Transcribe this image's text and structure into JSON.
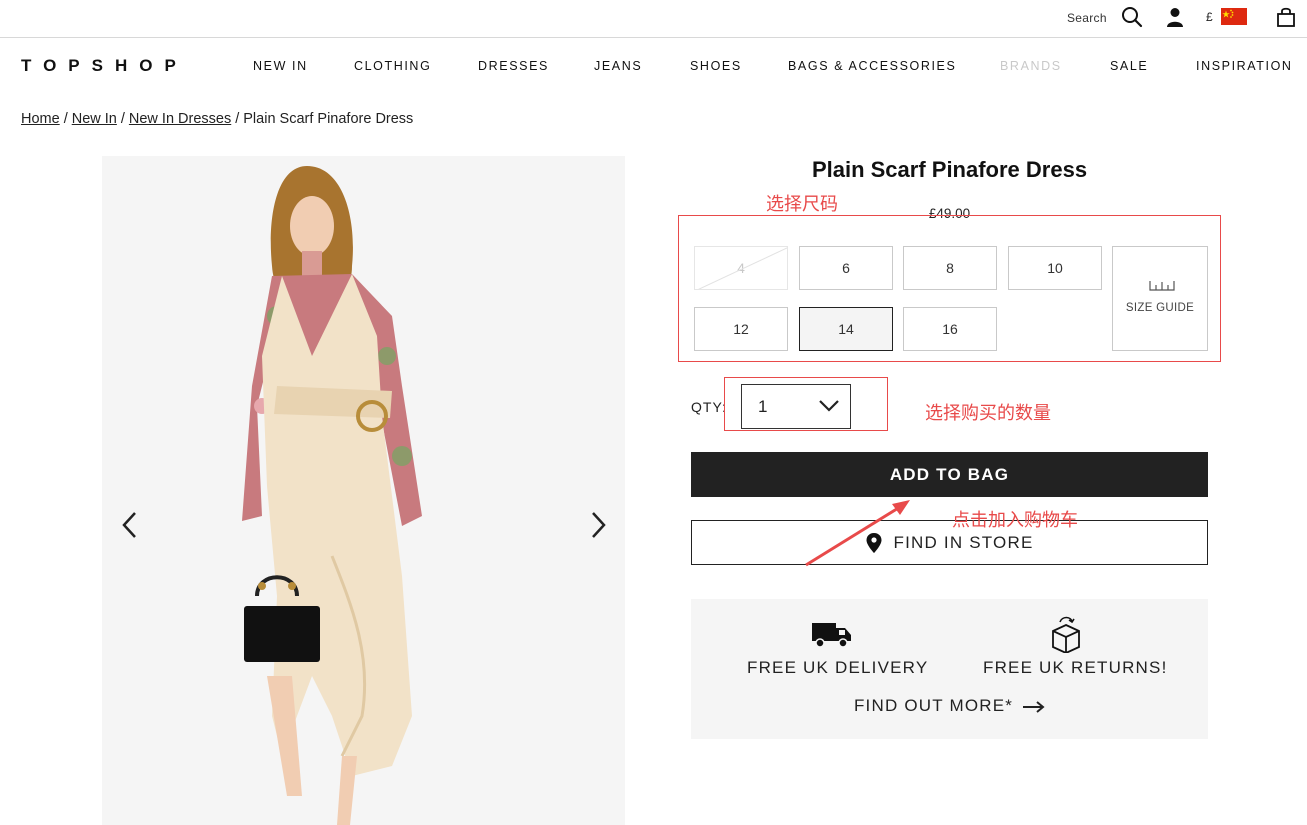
{
  "utility": {
    "search_label": "Search",
    "currency": "£",
    "icons": [
      "search-icon",
      "account-icon",
      "china-flag-icon",
      "shopping-bag-icon"
    ]
  },
  "brand": {
    "logo": "TOPSHOP"
  },
  "nav": {
    "items": [
      "NEW IN",
      "CLOTHING",
      "DRESSES",
      "JEANS",
      "SHOES",
      "BAGS & ACCESSORIES",
      "BRANDS",
      "SALE",
      "INSPIRATION"
    ]
  },
  "breadcrumb": {
    "items": [
      "Home",
      "New In",
      "New In Dresses",
      "Plain Scarf Pinafore Dress"
    ],
    "separator": "/"
  },
  "product": {
    "title": "Plain Scarf Pinafore Dress",
    "price": "£49.00",
    "sizes": [
      {
        "label": "4",
        "available": false,
        "selected": false
      },
      {
        "label": "6",
        "available": true,
        "selected": false
      },
      {
        "label": "8",
        "available": true,
        "selected": false
      },
      {
        "label": "10",
        "available": true,
        "selected": false
      },
      {
        "label": "12",
        "available": true,
        "selected": false
      },
      {
        "label": "14",
        "available": true,
        "selected": true
      },
      {
        "label": "16",
        "available": true,
        "selected": false
      }
    ],
    "size_guide_label": "SIZE GUIDE",
    "qty_label": "QTY:",
    "qty_value": "1",
    "add_to_bag": "ADD TO BAG",
    "find_in_store": "FIND IN STORE"
  },
  "delivery": {
    "delivery_label": "FREE UK DELIVERY",
    "returns_label": "FREE UK RETURNS!",
    "more_label": "FIND OUT MORE*"
  },
  "annotations": {
    "size_note": "选择尺码",
    "qty_note": "选择购买的数量",
    "bag_note": "点击加入购物车",
    "color": "#e84a4a"
  }
}
